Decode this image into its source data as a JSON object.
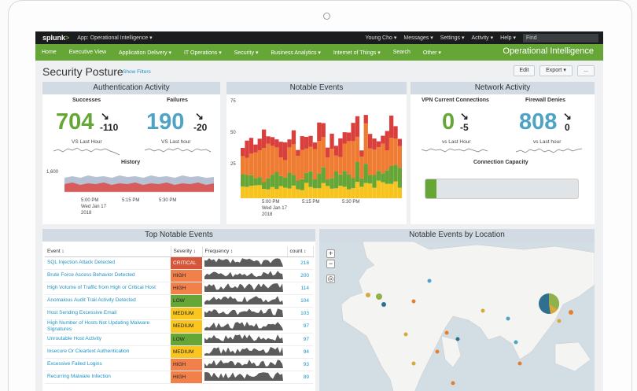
{
  "app": {
    "logo": "splunk",
    "logo_suffix": ">",
    "app_label": "App: Operational Intelligence ▾",
    "top_menu": [
      "Young Cho ▾",
      "Messages ▾",
      "Settings ▾",
      "Activity ▾",
      "Help ▾"
    ],
    "find_placeholder": "Find"
  },
  "nav": {
    "items": [
      "Home",
      "Executive View",
      "Application Delivery ▾",
      "IT Operations ▾",
      "Security ▾",
      "Business Analytics ▾",
      "Internet of Things ▾",
      "Search",
      "Other ▾"
    ],
    "app_title": "Operational Intelligence"
  },
  "page": {
    "title": "Security Posture",
    "show_filters": "Show Filters",
    "edit": "Edit",
    "export": "Export ▾",
    "more": "..."
  },
  "auth": {
    "title": "Authentication Activity",
    "successes_label": "Successes",
    "successes_value": "704",
    "successes_delta": "-110",
    "failures_label": "Failures",
    "failures_value": "190",
    "failures_delta": "-20",
    "vs_label": "VS Last Hour",
    "vs_label_2": "VS Last hour",
    "history_label": "History",
    "y_tick": "1,600",
    "x_ticks": [
      "5:00 PM",
      "5:15 PM",
      "5:30 PM"
    ],
    "x_date_1": "Wed Jan 17",
    "x_date_2": "2018"
  },
  "notable": {
    "title": "Notable Events",
    "y_ticks": [
      "75",
      "50",
      "25"
    ],
    "x_ticks": [
      "5:00 PM",
      "5:15 PM",
      "5:30 PM"
    ],
    "x_date_1": "Wed Jan 17",
    "x_date_2": "2018",
    "colors": [
      "#f7c41f",
      "#65a637",
      "#ee7d33",
      "#d93f3c"
    ]
  },
  "network": {
    "title": "Network Activity",
    "vpn_label": "VPN Current Connections",
    "vpn_value": "0",
    "vpn_delta": "-5",
    "fw_label": "Firewall Denies",
    "fw_value": "808",
    "fw_delta": "0",
    "vs_label": "vs Last Hour",
    "vs_label_2": "vs Last hour",
    "capacity_label": "Connection Capacity",
    "capacity_fill": 0.07
  },
  "top_events": {
    "title": "Top Notable Events",
    "columns": [
      "Event ↕",
      "Severity ↕",
      "Frequency ↕",
      "count ↕"
    ],
    "rows": [
      {
        "event": "SQL Injection Attack Detected",
        "severity": "CRITICAL",
        "count": "218"
      },
      {
        "event": "Brute Force Access Behavior Detected",
        "severity": "HIGH",
        "count": "200"
      },
      {
        "event": "High Volume of Traffic from High or Critical Host",
        "severity": "HIGH",
        "count": "114"
      },
      {
        "event": "Anomalous Audit Trail Activity Detected",
        "severity": "LOW",
        "count": "104"
      },
      {
        "event": "Host Sending Excessive Email",
        "severity": "MEDIUM",
        "count": "103"
      },
      {
        "event": "High Number of Hosts Not Updating Malware Signatures",
        "severity": "MEDIUM",
        "count": "97"
      },
      {
        "event": "Unroutable Host Activity",
        "severity": "LOW",
        "count": "97"
      },
      {
        "event": "Insecure Or Cleartext Authentication",
        "severity": "MEDIUM",
        "count": "94"
      },
      {
        "event": "Excessive Failed Logins",
        "severity": "HIGH",
        "count": "93"
      },
      {
        "event": "Recurring Malware Infection",
        "severity": "HIGH",
        "count": "89"
      }
    ]
  },
  "map": {
    "title": "Notable Events by Location",
    "zoom_in": "+",
    "zoom_out": "−",
    "locate": "◎"
  },
  "colors": {
    "accent": "#65a637",
    "success_value": "#65a637",
    "failure_value": "#4fa3c4",
    "panel_header": "#d2dbe3"
  },
  "icons": [
    "down-right-arrow-icon",
    "zoom-in-icon",
    "zoom-out-icon",
    "locate-icon"
  ]
}
